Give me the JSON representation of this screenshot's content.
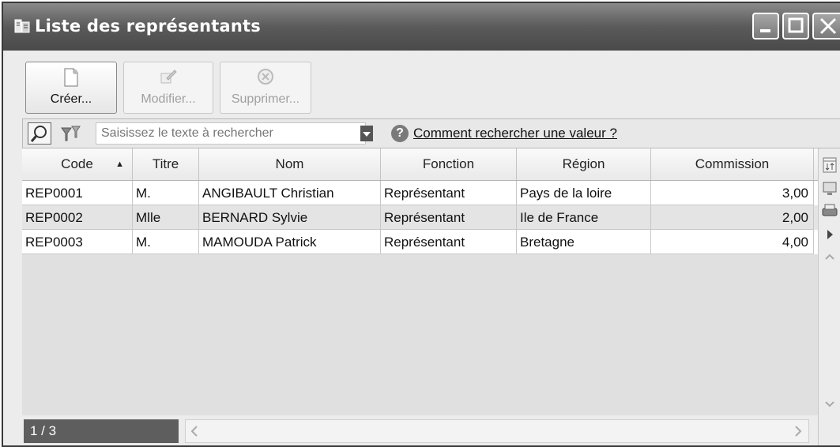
{
  "window": {
    "title": "Liste des représentants",
    "icon": "app-list-icon",
    "controls": [
      "minimize-icon",
      "maximize-icon",
      "close-icon"
    ]
  },
  "toolbar": {
    "create_label": "Créer...",
    "modify_label": "Modifier...",
    "delete_label": "Supprimer..."
  },
  "search": {
    "placeholder": "Saisissez le texte à rechercher",
    "value": "",
    "help_link": "Comment rechercher une valeur ?"
  },
  "table": {
    "columns": [
      "Code",
      "Titre",
      "Nom",
      "Fonction",
      "Région",
      "Commission"
    ],
    "sorted_column": "Code",
    "sort_direction": "ascending",
    "rows": [
      [
        "REP0001",
        "M.",
        "ANGIBAULT Christian",
        "Représentant",
        "Pays de la loire",
        "3,00"
      ],
      [
        "REP0002",
        "Mlle",
        "BERNARD Sylvie",
        "Représentant",
        "Ile de France",
        "2,00"
      ],
      [
        "REP0003",
        "M.",
        "MAMOUDA Patrick",
        "Représentant",
        "Bretagne",
        "4,00"
      ]
    ]
  },
  "footer": {
    "record_count": "1 / 3"
  },
  "colors": {
    "titlebar": "#5a5a5a",
    "count_badge": "#5e5e5e",
    "selected_row": "#e4e4e4"
  }
}
